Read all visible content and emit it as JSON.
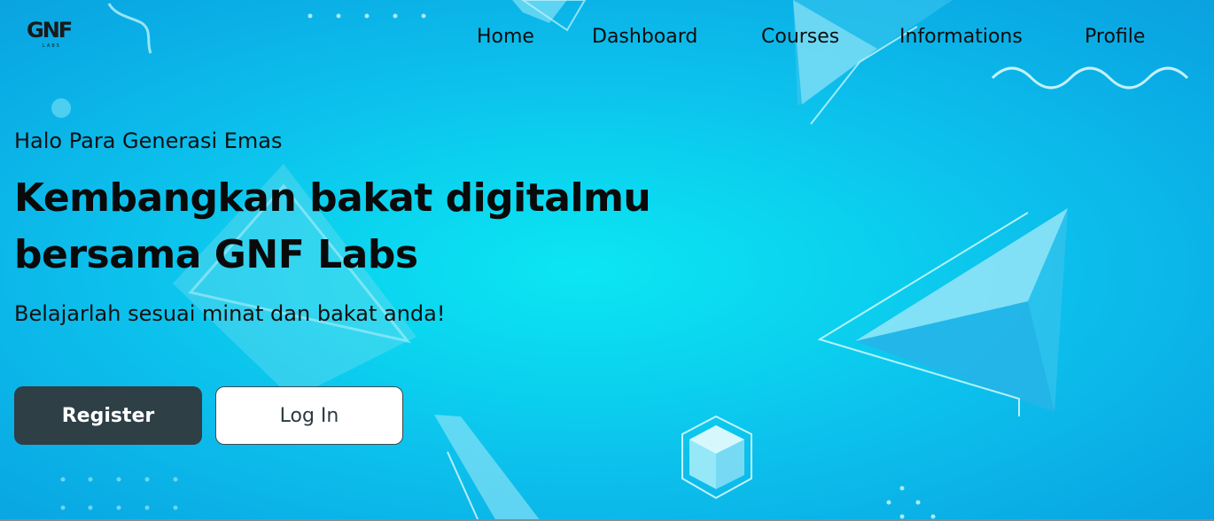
{
  "brand": {
    "logo_text": "GNF",
    "logo_sub": "LABS"
  },
  "nav": {
    "items": [
      {
        "label": "Home"
      },
      {
        "label": "Dashboard"
      },
      {
        "label": "Courses"
      },
      {
        "label": "Informations"
      },
      {
        "label": "Profile"
      }
    ]
  },
  "hero": {
    "kicker": "Halo Para Generasi Emas",
    "headline_line1": "Kembangkan bakat digitalmu",
    "headline_line2": "bersama GNF Labs",
    "subline": "Belajarlah sesuai minat dan bakat anda!"
  },
  "actions": {
    "register_label": "Register",
    "login_label": "Log In"
  },
  "colors": {
    "background": "#0bd3ef",
    "register_bg": "#2e3f46",
    "login_bg": "#ffffff"
  }
}
